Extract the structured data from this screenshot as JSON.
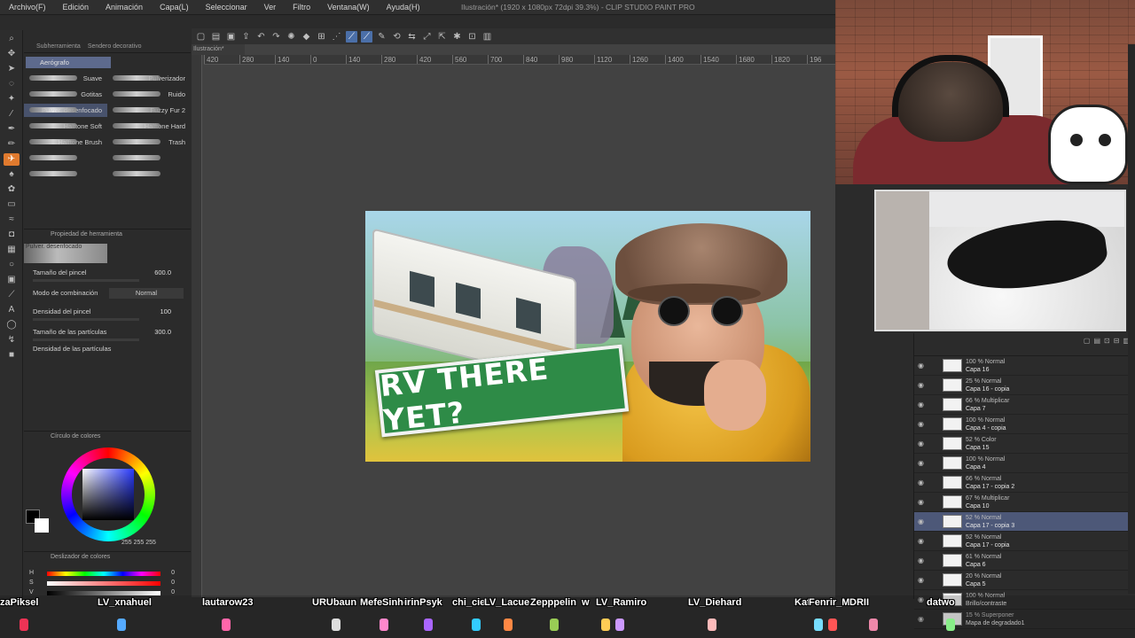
{
  "menu": [
    "Archivo(F)",
    "Edición",
    "Animación",
    "Capa(L)",
    "Seleccionar",
    "Ver",
    "Filtro",
    "Ventana(W)",
    "Ayuda(H)"
  ],
  "window_title": "Ilustración* (1920 x 1080px 72dpi 39.3%) - CLIP STUDIO PAINT PRO",
  "subtool": {
    "tabs": [
      "Subherramienta",
      "Sendero decorativo"
    ],
    "group": "Aerógrafo",
    "brushes": [
      "Suave",
      "Pulverizador",
      "Gotitas",
      "Ruido",
      "Pulver. desenfocado",
      "Fuzzy Fur 2",
      "Halftone Soft",
      "Halftone Hard",
      "Halftone Brush",
      "Trash",
      "",
      "",
      "",
      "",
      "",
      ""
    ],
    "selected": "Pulver. desenfocado"
  },
  "tool_property": {
    "title": "Propiedad de herramienta",
    "preset": "Pulver. desenfocado",
    "brush_size_label": "Tamaño del pincel",
    "brush_size": "600.0",
    "blend_label": "Modo de combinación",
    "blend_value": "Normal",
    "density_label": "Densidad del pincel",
    "density": "100",
    "particle_size_label": "Tamaño de las partículas",
    "particle_size": "300.0",
    "particle_density_label": "Densidad de las partículas"
  },
  "color_circle": {
    "title": "Círculo de colores",
    "rgb": "255  255  255"
  },
  "color_slider": {
    "title": "Deslizador de colores",
    "rows": [
      {
        "label": "H",
        "value": "0"
      },
      {
        "label": "S",
        "value": "0"
      },
      {
        "label": "V",
        "value": "0"
      }
    ]
  },
  "canvas": {
    "tab": "Ilustración*",
    "ruler": [
      "420",
      "280",
      "140",
      "0",
      "140",
      "280",
      "420",
      "560",
      "700",
      "840",
      "980",
      "1120",
      "1260",
      "1400",
      "1540",
      "1680",
      "1820",
      "196"
    ],
    "artwork_text": "RV THERE YET?"
  },
  "layers": [
    {
      "mode": "100 % Normal",
      "name": "Capa 16",
      "sel": false
    },
    {
      "mode": "25 % Normal",
      "name": "Capa 16 - copia",
      "sel": false
    },
    {
      "mode": "66 % Multiplicar",
      "name": "Capa 7",
      "sel": false
    },
    {
      "mode": "100 % Normal",
      "name": "Capa 4 - copia",
      "sel": false
    },
    {
      "mode": "52 % Color",
      "name": "Capa 15",
      "sel": false
    },
    {
      "mode": "100 % Normal",
      "name": "Capa 4",
      "sel": false
    },
    {
      "mode": "66 % Normal",
      "name": "Capa 17 - copia 2",
      "sel": false
    },
    {
      "mode": "67 % Multiplicar",
      "name": "Capa 10",
      "sel": false
    },
    {
      "mode": "52 % Normal",
      "name": "Capa 17 - copia 3",
      "sel": true
    },
    {
      "mode": "52 % Normal",
      "name": "Capa 17 - copia",
      "sel": false
    },
    {
      "mode": "61 % Normal",
      "name": "Capa 6",
      "sel": false
    },
    {
      "mode": "20 % Normal",
      "name": "Capa 5",
      "sel": false
    },
    {
      "mode": "100 % Normal",
      "name": "Brillo/contraste",
      "sel": false
    },
    {
      "mode": "15 % Superponer",
      "name": "Mapa de degradado1",
      "sel": false
    }
  ],
  "viewers": [
    "zaPiksel",
    "LV_xnahuel",
    "lautarow23",
    "URUbaun",
    "MefeSinho",
    "irinPsyk",
    "chi_cie",
    "LV_Lacue",
    "Zepppelin",
    "w",
    "LV_Ramiro",
    "LV_Diehard",
    "Kat",
    "Fenrir_MVP",
    "DRII",
    "datwo"
  ],
  "colors": {
    "accent": "#e07a2e",
    "selection": "#4d5878",
    "sign": "#2e8b47"
  }
}
